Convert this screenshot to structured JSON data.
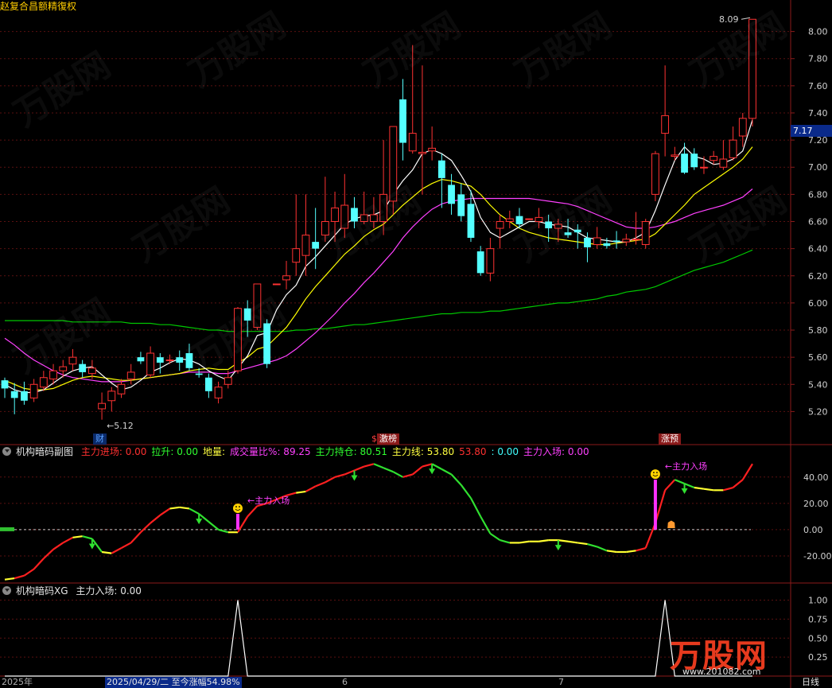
{
  "main_panel": {
    "price_axis": [
      "8.00",
      "7.80",
      "7.60",
      "7.40",
      "7.20",
      "7.00",
      "6.80",
      "6.60",
      "6.40",
      "6.20",
      "6.00",
      "5.80",
      "5.60",
      "5.40",
      "5.20"
    ],
    "last_price": "7.17",
    "high_label": "8.09",
    "low_label": "5.12",
    "event_tags": [
      {
        "text": "财",
        "color": "#5aa0ff",
        "bg": "#0a2a6a"
      },
      {
        "text": "激榜",
        "color": "#ffffff",
        "bg": "#8b1a1a",
        "prefix": "$"
      },
      {
        "text": "涨预",
        "color": "#ffffff",
        "bg": "#8b1a1a"
      }
    ]
  },
  "sub_panel_1": {
    "title": "机构暗码副图",
    "indicators": [
      {
        "label": "主力进场: 0.00",
        "color": "#ff3030"
      },
      {
        "label": "拉升: 0.00",
        "color": "#30ff30"
      },
      {
        "label": "地量:",
        "color": "#ffff40"
      },
      {
        "label": "成交量比%: 89.25",
        "color": "#ff40ff"
      },
      {
        "label": "主力持仓: 80.51",
        "color": "#30ff30"
      },
      {
        "label": "主力线: 53.80",
        "color": "#ffff40"
      },
      {
        "label": "53.80",
        "color": "#ff3030"
      },
      {
        "label": ": 0.00",
        "color": "#40ffff"
      },
      {
        "label": "主力入场: 0.00",
        "color": "#ff40ff"
      }
    ],
    "axis": [
      "40.00",
      "20.00",
      "0.00",
      "-20.00"
    ],
    "annotation": "主力入场"
  },
  "sub_panel_2": {
    "title": "机构暗码XG",
    "indicator": "主力入场: 0.00",
    "axis": [
      "1.00",
      "0.75",
      "0.50",
      "0.25"
    ]
  },
  "bottom_bar": {
    "year": "2025年",
    "info": "2025/04/29/二 至今涨幅54.98%",
    "month_6": "6",
    "month_7": "7",
    "period": "日线"
  },
  "watermark": {
    "logo": "万股网",
    "url": "www.201082.com"
  },
  "colors": {
    "up": "#ff3232",
    "down": "#54ffff",
    "ma5": "#ffffff",
    "ma10": "#ffff00",
    "ma20": "#ff40ff",
    "ma60": "#00c800"
  },
  "chart_data": {
    "type": "candlestick",
    "series": [
      {
        "name": "candles",
        "ohlc": [
          [
            5.43,
            5.37,
            5.45,
            5.3
          ],
          [
            5.35,
            5.3,
            5.41,
            5.18
          ],
          [
            5.35,
            5.28,
            5.42,
            5.25
          ],
          [
            5.3,
            5.4,
            5.44,
            5.27
          ],
          [
            5.38,
            5.45,
            5.5,
            5.35
          ],
          [
            5.44,
            5.5,
            5.55,
            5.4
          ],
          [
            5.5,
            5.53,
            5.58,
            5.45
          ],
          [
            5.55,
            5.6,
            5.66,
            5.5
          ],
          [
            5.55,
            5.49,
            5.58,
            5.45
          ],
          [
            5.48,
            5.52,
            5.58,
            5.44
          ],
          [
            5.22,
            5.26,
            5.34,
            5.14
          ],
          [
            5.28,
            5.35,
            5.38,
            5.2
          ],
          [
            5.33,
            5.4,
            5.44,
            5.3
          ],
          [
            5.44,
            5.49,
            5.55,
            5.4
          ],
          [
            5.6,
            5.57,
            5.64,
            5.55
          ],
          [
            5.47,
            5.63,
            5.68,
            5.45
          ],
          [
            5.6,
            5.56,
            5.63,
            5.48
          ],
          [
            5.58,
            5.58,
            5.62,
            5.55
          ],
          [
            5.6,
            5.56,
            5.65,
            5.5
          ],
          [
            5.63,
            5.52,
            5.7,
            5.5
          ],
          [
            5.48,
            5.47,
            5.52,
            5.45
          ],
          [
            5.45,
            5.35,
            5.48,
            5.3
          ],
          [
            5.3,
            5.38,
            5.42,
            5.26
          ],
          [
            5.4,
            5.45,
            5.5,
            5.37
          ],
          [
            5.5,
            5.96,
            5.97,
            5.48
          ],
          [
            5.96,
            5.87,
            6.02,
            5.75
          ],
          [
            5.82,
            6.14,
            6.14,
            5.8
          ],
          [
            5.85,
            5.55,
            5.88,
            5.52
          ],
          [
            6.14,
            6.14,
            6.14,
            6.14
          ],
          [
            6.17,
            6.2,
            6.31,
            6.1
          ],
          [
            6.3,
            6.4,
            6.8,
            6.2
          ],
          [
            6.35,
            6.5,
            6.8,
            6.2
          ],
          [
            6.45,
            6.4,
            6.7,
            6.25
          ],
          [
            6.5,
            6.6,
            6.93,
            6.45
          ],
          [
            6.6,
            6.7,
            6.82,
            6.45
          ],
          [
            6.55,
            6.72,
            6.95,
            6.48
          ],
          [
            6.7,
            6.6,
            6.78,
            6.55
          ],
          [
            6.6,
            6.65,
            6.82,
            6.58
          ],
          [
            6.6,
            6.65,
            6.78,
            6.55
          ],
          [
            6.6,
            6.8,
            7.2,
            6.5
          ],
          [
            6.75,
            7.3,
            7.3,
            6.65
          ],
          [
            7.5,
            7.18,
            7.65,
            7.05
          ],
          [
            7.12,
            7.25,
            7.9,
            7.1
          ],
          [
            7.1,
            7.11,
            7.75,
            6.8
          ],
          [
            7.12,
            7.14,
            7.3,
            7.05
          ],
          [
            7.05,
            6.92,
            7.1,
            6.7
          ],
          [
            6.87,
            6.73,
            6.95,
            6.65
          ],
          [
            6.8,
            6.64,
            6.88,
            6.6
          ],
          [
            6.73,
            6.48,
            6.83,
            6.45
          ],
          [
            6.38,
            6.22,
            6.42,
            6.2
          ],
          [
            6.22,
            6.4,
            6.48,
            6.16
          ],
          [
            6.55,
            6.6,
            6.65,
            6.4
          ],
          [
            6.6,
            6.62,
            6.68,
            6.55
          ],
          [
            6.64,
            6.58,
            6.7,
            6.55
          ],
          [
            6.62,
            6.62,
            6.62,
            6.62
          ],
          [
            6.6,
            6.63,
            6.7,
            6.55
          ],
          [
            6.6,
            6.55,
            6.65,
            6.45
          ],
          [
            6.55,
            6.58,
            6.62,
            6.45
          ],
          [
            6.52,
            6.5,
            6.62,
            6.48
          ],
          [
            6.54,
            6.52,
            6.58,
            6.4
          ],
          [
            6.48,
            6.41,
            6.52,
            6.3
          ],
          [
            6.43,
            6.48,
            6.56,
            6.4
          ],
          [
            6.44,
            6.42,
            6.48,
            6.4
          ],
          [
            6.46,
            6.45,
            6.53,
            6.4
          ],
          [
            6.45,
            6.47,
            6.51,
            6.42
          ],
          [
            6.47,
            6.47,
            6.67,
            6.43
          ],
          [
            6.43,
            6.6,
            6.62,
            6.4
          ],
          [
            6.8,
            7.1,
            7.12,
            6.75
          ],
          [
            7.25,
            7.38,
            7.75,
            7.08
          ],
          [
            7.08,
            7.09,
            7.15,
            7.05
          ],
          [
            7.1,
            6.96,
            7.18,
            6.95
          ],
          [
            7.1,
            7.0,
            7.14,
            6.98
          ],
          [
            7.0,
            7.0,
            7.08,
            6.95
          ],
          [
            7.05,
            7.08,
            7.12,
            7.02
          ],
          [
            7.0,
            7.06,
            7.2,
            6.98
          ],
          [
            7.07,
            7.2,
            7.3,
            7.05
          ],
          [
            7.23,
            7.36,
            7.4,
            7.15
          ],
          [
            7.36,
            8.09,
            8.09,
            7.3
          ]
        ]
      },
      {
        "name": "ma60",
        "values": [
          5.87,
          5.87,
          5.87,
          5.87,
          5.87,
          5.87,
          5.87,
          5.86,
          5.86,
          5.86,
          5.86,
          5.86,
          5.86,
          5.85,
          5.85,
          5.85,
          5.84,
          5.84,
          5.83,
          5.82,
          5.81,
          5.8,
          5.8,
          5.79,
          5.79,
          5.79,
          5.79,
          5.79,
          5.79,
          5.79,
          5.8,
          5.8,
          5.81,
          5.81,
          5.82,
          5.83,
          5.84,
          5.84,
          5.85,
          5.86,
          5.87,
          5.88,
          5.89,
          5.9,
          5.91,
          5.92,
          5.92,
          5.93,
          5.93,
          5.93,
          5.94,
          5.94,
          5.95,
          5.96,
          5.97,
          5.98,
          5.99,
          6.0,
          6.0,
          6.01,
          6.02,
          6.03,
          6.05,
          6.06,
          6.08,
          6.09,
          6.1,
          6.12,
          6.15,
          6.18,
          6.21,
          6.24,
          6.26,
          6.28,
          6.3,
          6.33,
          6.36,
          6.39
        ]
      },
      {
        "name": "ma20",
        "values": [
          5.74,
          5.69,
          5.63,
          5.58,
          5.54,
          5.5,
          5.47,
          5.45,
          5.44,
          5.43,
          5.42,
          5.42,
          5.42,
          5.43,
          5.44,
          5.45,
          5.46,
          5.47,
          5.48,
          5.49,
          5.49,
          5.49,
          5.48,
          5.48,
          5.5,
          5.52,
          5.54,
          5.56,
          5.58,
          5.61,
          5.66,
          5.72,
          5.78,
          5.85,
          5.92,
          6.0,
          6.07,
          6.15,
          6.22,
          6.3,
          6.38,
          6.48,
          6.56,
          6.63,
          6.69,
          6.73,
          6.75,
          6.76,
          6.77,
          6.77,
          6.77,
          6.77,
          6.77,
          6.77,
          6.77,
          6.76,
          6.75,
          6.74,
          6.73,
          6.71,
          6.68,
          6.65,
          6.62,
          6.59,
          6.56,
          6.55,
          6.55,
          6.56,
          6.58,
          6.6,
          6.63,
          6.66,
          6.68,
          6.7,
          6.72,
          6.75,
          6.78,
          6.84
        ]
      },
      {
        "name": "ma10",
        "values": [
          5.43,
          5.4,
          5.37,
          5.36,
          5.36,
          5.37,
          5.4,
          5.43,
          5.45,
          5.46,
          5.45,
          5.44,
          5.43,
          5.43,
          5.44,
          5.45,
          5.46,
          5.47,
          5.48,
          5.5,
          5.51,
          5.52,
          5.51,
          5.51,
          5.56,
          5.6,
          5.66,
          5.68,
          5.75,
          5.82,
          5.92,
          6.03,
          6.12,
          6.2,
          6.28,
          6.36,
          6.42,
          6.49,
          6.54,
          6.58,
          6.65,
          6.72,
          6.78,
          6.84,
          6.88,
          6.91,
          6.9,
          6.88,
          6.86,
          6.8,
          6.72,
          6.65,
          6.6,
          6.55,
          6.52,
          6.5,
          6.48,
          6.47,
          6.46,
          6.45,
          6.44,
          6.43,
          6.43,
          6.44,
          6.45,
          6.46,
          6.47,
          6.51,
          6.58,
          6.65,
          6.72,
          6.8,
          6.85,
          6.9,
          6.95,
          7.0,
          7.06,
          7.15
        ]
      },
      {
        "name": "ma5",
        "values": [
          5.4,
          5.36,
          5.34,
          5.34,
          5.36,
          5.41,
          5.46,
          5.5,
          5.52,
          5.53,
          5.47,
          5.41,
          5.36,
          5.38,
          5.43,
          5.49,
          5.52,
          5.56,
          5.59,
          5.58,
          5.55,
          5.5,
          5.46,
          5.43,
          5.52,
          5.61,
          5.76,
          5.78,
          5.95,
          6.06,
          6.13,
          6.27,
          6.34,
          6.42,
          6.5,
          6.58,
          6.62,
          6.64,
          6.65,
          6.68,
          6.8,
          6.9,
          6.98,
          7.1,
          7.13,
          7.1,
          7.05,
          6.94,
          6.82,
          6.63,
          6.52,
          6.48,
          6.52,
          6.56,
          6.6,
          6.6,
          6.58,
          6.57,
          6.56,
          6.52,
          6.48,
          6.47,
          6.46,
          6.45,
          6.45,
          6.48,
          6.52,
          6.68,
          6.87,
          7.05,
          7.15,
          7.08,
          7.06,
          7.02,
          7.03,
          7.06,
          7.12,
          7.35
        ]
      },
      {
        "name": "主力线",
        "values": [
          -38,
          -37,
          -35,
          -30,
          -22,
          -15,
          -10,
          -6,
          -5,
          -7,
          -17,
          -18,
          -14,
          -10,
          -2,
          5,
          11,
          16,
          17,
          16,
          12,
          6,
          0,
          -2,
          -2,
          10,
          18,
          20,
          23,
          26,
          28,
          29,
          33,
          36,
          40,
          42,
          45,
          48,
          50,
          47,
          44,
          40,
          42,
          48,
          50,
          46,
          42,
          34,
          24,
          10,
          -3,
          -8,
          -10,
          -10,
          -9,
          -9,
          -8,
          -8,
          -9,
          -10,
          -11,
          -13,
          -16,
          -17,
          -17,
          -16,
          -14,
          5,
          30,
          38,
          35,
          32,
          31,
          30,
          30,
          32,
          38,
          50
        ]
      },
      {
        "name": "主力入场XG",
        "values": [
          0,
          0,
          0,
          0,
          0,
          0,
          0,
          0,
          0,
          0,
          0,
          0,
          0,
          0,
          0,
          0,
          0,
          0,
          0,
          0,
          0,
          0,
          0,
          0,
          1,
          0,
          0,
          0,
          0,
          0,
          0,
          0,
          0,
          0,
          0,
          0,
          0,
          0,
          0,
          0,
          0,
          0,
          0,
          0,
          0,
          0,
          0,
          0,
          0,
          0,
          0,
          0,
          0,
          0,
          0,
          0,
          0,
          0,
          0,
          0,
          0,
          0,
          0,
          0,
          0,
          0,
          0,
          0,
          1,
          0,
          0,
          0,
          0,
          0,
          0,
          0,
          0,
          0
        ]
      }
    ],
    "ylim_main": [
      5.05,
      8.15
    ],
    "ylim_sub1": [
      -40,
      55
    ],
    "ylim_sub2": [
      0,
      1.1
    ]
  }
}
